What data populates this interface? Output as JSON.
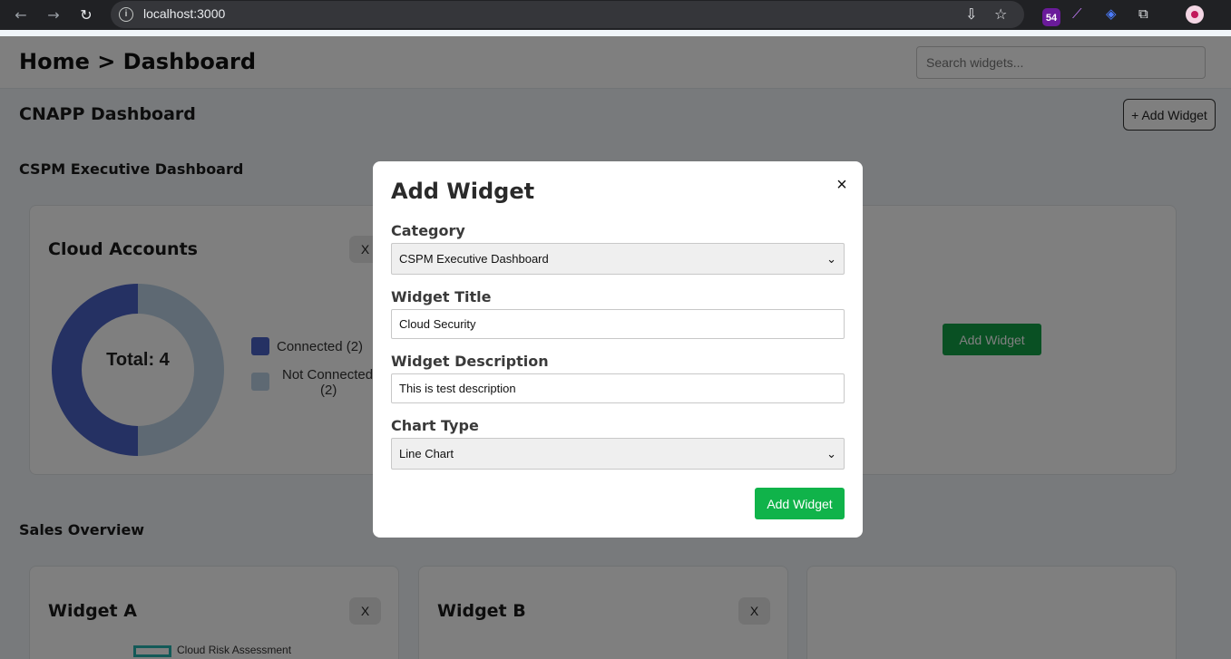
{
  "browser": {
    "url": "localhost:3000",
    "extension_badge": "54"
  },
  "header": {
    "breadcrumb": "Home > Dashboard",
    "search_placeholder": "Search widgets..."
  },
  "dashboard": {
    "title": "CNAPP Dashboard",
    "add_widget_label": "+ Add Widget"
  },
  "categories": [
    {
      "name": "CSPM Executive Dashboard",
      "widgets": [
        {
          "title": "Cloud Accounts",
          "remove_label": "X",
          "total_label": "Total: 4",
          "legend": [
            {
              "label": "Connected (2)",
              "color": "#4a63c6",
              "value": 2
            },
            {
              "label_line1": "Not Connected",
              "label_line2": "(2)",
              "color": "#bcd3e6",
              "value": 2
            }
          ]
        }
      ],
      "add_widget_button": "Add Widget"
    },
    {
      "name": "Sales Overview",
      "widgets": [
        {
          "title": "Widget A",
          "remove_label": "X",
          "legend_label": "Cloud Risk Assessment"
        },
        {
          "title": "Widget B",
          "remove_label": "X"
        }
      ]
    }
  ],
  "modal": {
    "title": "Add Widget",
    "close_symbol": "×",
    "category_label": "Category",
    "category_value": "CSPM Executive Dashboard",
    "widget_title_label": "Widget Title",
    "widget_title_value": "Cloud Security",
    "widget_description_label": "Widget Description",
    "widget_description_value": "This is test description",
    "chart_type_label": "Chart Type",
    "chart_type_value": "Line Chart",
    "submit_label": "Add Widget"
  },
  "colors": {
    "accent_green": "#10b34a",
    "donut_connected": "#4a63c6",
    "donut_not_connected": "#bcd3e6"
  }
}
